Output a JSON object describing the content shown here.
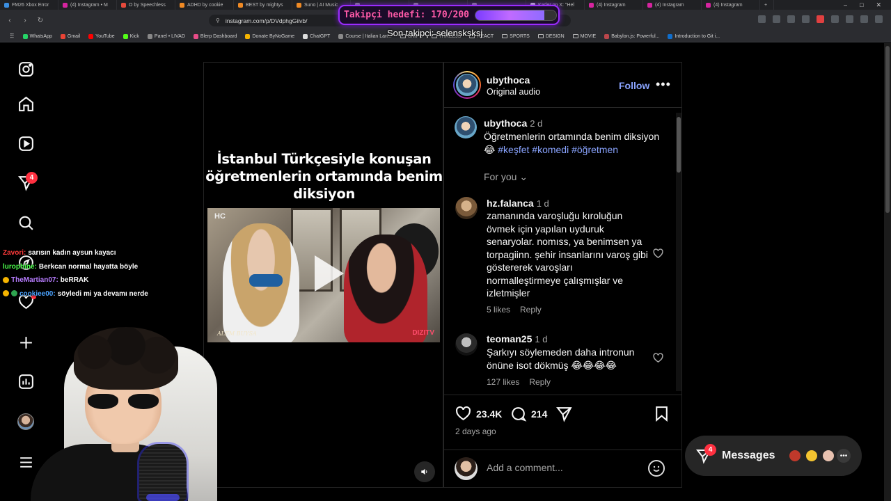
{
  "browser": {
    "tabs": [
      {
        "label": "FM26 Xbox Error",
        "color": "#3b8ee0"
      },
      {
        "label": "(4) Instagram • M",
        "color": "#d6249f"
      },
      {
        "label": "O by Speechless",
        "color": "#e64a3c"
      },
      {
        "label": "ADHD by cookie",
        "color": "#f08a24"
      },
      {
        "label": "BEST by mightys",
        "color": "#f08a24"
      },
      {
        "label": "Suno | AI Music",
        "color": "#f08a24"
      },
      {
        "label": "",
        "color": "#888"
      },
      {
        "label": "",
        "color": "#888"
      },
      {
        "label": "",
        "color": "#888"
      },
      {
        "label": "Kader on X: \"Hel",
        "color": "#cccccc"
      },
      {
        "label": "(4) Instagram",
        "color": "#d6249f"
      },
      {
        "label": "(4) Instagram",
        "color": "#d6249f"
      },
      {
        "label": "(4) Instagram",
        "color": "#d6249f"
      }
    ],
    "new_tab": "+",
    "window_controls": [
      "–",
      "□",
      "✕"
    ],
    "url": "instagram.com/p/DVdphgGiivb/",
    "bookmarks": [
      {
        "label": "WhatsApp",
        "color": "#25d366",
        "folder": false
      },
      {
        "label": "Gmail",
        "color": "#ea4335",
        "folder": false
      },
      {
        "label": "YouTube",
        "color": "#ff0000",
        "folder": false
      },
      {
        "label": "Kick",
        "color": "#53fc18",
        "folder": false
      },
      {
        "label": "Panel • LIVAD",
        "color": "#888888",
        "folder": false
      },
      {
        "label": "Blerp Dashboard",
        "color": "#e84c88",
        "folder": false
      },
      {
        "label": "Donate ByNoGame",
        "color": "#f5b400",
        "folder": false
      },
      {
        "label": "ChatGPT",
        "color": "#dddddd",
        "folder": false
      },
      {
        "label": "Course | Italian Lan...",
        "color": "#8a8a8a",
        "folder": false
      },
      {
        "label": "UNIPD",
        "color": "",
        "folder": true
      },
      {
        "label": "THREEJS",
        "color": "",
        "folder": true
      },
      {
        "label": "REACT",
        "color": "",
        "folder": true
      },
      {
        "label": "SPORTS",
        "color": "",
        "folder": true
      },
      {
        "label": "DESIGN",
        "color": "",
        "folder": true
      },
      {
        "label": "MOVIE",
        "color": "",
        "folder": true
      },
      {
        "label": "Babylon.js: Powerful...",
        "color": "#bb464b",
        "folder": false
      },
      {
        "label": "Introduction to Git i...",
        "color": "#0f6ecd",
        "folder": false
      }
    ]
  },
  "stream": {
    "goal_text": "Takipçi hedefi: 170/200",
    "goal_progress": 0.85,
    "last_follower": "Son takipçi: selensksksj",
    "chat": [
      {
        "user": "Zavori:",
        "user_color": "#ff3b3b",
        "message": "sarısın kadın aysun kayacı",
        "badge": ""
      },
      {
        "user": "lurophine:",
        "user_color": "#4cff4c",
        "message": "Berkcan normal hayatta böyle",
        "badge": ""
      },
      {
        "user": "TheMartian07:",
        "user_color": "#b77cff",
        "message": "beRRAK",
        "badge": "gold"
      },
      {
        "user": "cookiee00:",
        "user_color": "#4aa3ff",
        "message": "söyledi mi ya devamı nerde",
        "badge": "gold-green"
      }
    ]
  },
  "nav": {
    "notifications_badge": "4"
  },
  "post": {
    "overlay_caption": "İstanbul Türkçesiyle konuşan öğretmenlerin ortamında benim diksiyon",
    "watermark_left": "HC",
    "watermark_bottom": "ALEM BUYSA",
    "watermark_right": "DIZITV",
    "author": "ubythoca",
    "audio": "Original audio",
    "follow_label": "Follow",
    "more_label": "•••",
    "caption": {
      "user": "ubythoca",
      "time": "2 d",
      "text": "Öğretmenlerin ortamında benim diksiyon😂",
      "tags": "#keşfet #komedi #öğretmen"
    },
    "for_you_label": "For you ⌄",
    "comments": [
      {
        "user": "hz.falanca",
        "time": "1 d",
        "text": "zamanında varoşluğu kıroluğun övmek için yapılan uyduruk senaryolar. nomıss, ya benimsen ya torpagiinn. şehir insanlarını varoş gibi göstererek varoşları normalleştirmeye çalışmışlar ve izletmişler",
        "likes": "5 likes",
        "reply": "Reply"
      },
      {
        "user": "teoman25",
        "time": "1 d",
        "text": "Şarkıyı söylemeden daha intronun önüne isot dökmüş 😂😂😂😂",
        "likes": "127 likes",
        "reply": "Reply"
      }
    ],
    "like_count": "23.4K",
    "comment_count": "214",
    "time_ago": "2 days ago",
    "add_comment_placeholder": "Add a comment..."
  },
  "messages": {
    "label": "Messages",
    "badge": "4",
    "more": "•••"
  },
  "colors": {
    "accent_link": "#8aa4ff",
    "badge_red": "#ff3040",
    "goal_border": "#9b2cff"
  }
}
